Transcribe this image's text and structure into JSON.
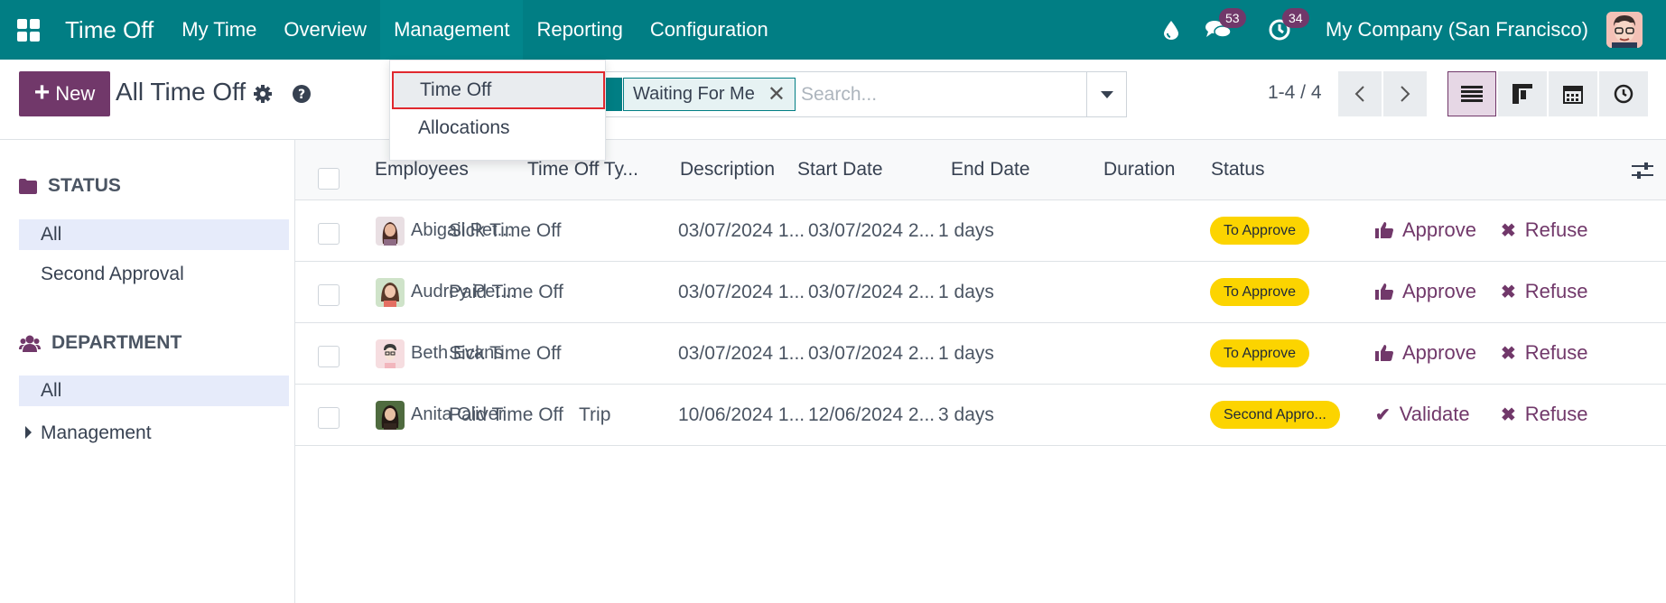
{
  "topbar": {
    "app_name": "Time Off",
    "menus": [
      {
        "label": "My Time",
        "active": false
      },
      {
        "label": "Overview",
        "active": false
      },
      {
        "label": "Management",
        "active": true
      },
      {
        "label": "Reporting",
        "active": false
      },
      {
        "label": "Configuration",
        "active": false
      }
    ],
    "messages_count": "53",
    "activities_count": "34",
    "company": "My Company (San Francisco)"
  },
  "control": {
    "new_label": "New",
    "title": "All Time Off",
    "facet": "Waiting For Me",
    "search_placeholder": "Search...",
    "pager": "1-4 / 4"
  },
  "dropdown": {
    "items": [
      "Time Off",
      "Allocations"
    ],
    "highlighted": "Time Off"
  },
  "sidebar": {
    "status_heading": "STATUS",
    "status_items": [
      "All",
      "Second Approval"
    ],
    "department_heading": "DEPARTMENT",
    "department_items": [
      "All",
      "Management"
    ]
  },
  "table": {
    "headers": [
      "Employees",
      "Time Off Ty...",
      "Description",
      "Start Date",
      "End Date",
      "Duration",
      "Status"
    ],
    "rows": [
      {
        "employee": "Abigail Pet...",
        "type": "Sick Time Off",
        "description": "",
        "start": "03/07/2024 1...",
        "end": "03/07/2024 2...",
        "duration": "1 days",
        "status": "To Approve",
        "action": "Approve",
        "refuse": "Refuse"
      },
      {
        "employee": "Audrey Pet...",
        "type": "Paid Time Off",
        "description": "",
        "start": "03/07/2024 1...",
        "end": "03/07/2024 2...",
        "duration": "1 days",
        "status": "To Approve",
        "action": "Approve",
        "refuse": "Refuse"
      },
      {
        "employee": "Beth Evans",
        "type": "Sick Time Off",
        "description": "",
        "start": "03/07/2024 1...",
        "end": "03/07/2024 2...",
        "duration": "1 days",
        "status": "To Approve",
        "action": "Approve",
        "refuse": "Refuse"
      },
      {
        "employee": "Anita Oliver",
        "type": "Paid Time Off",
        "description": "Trip",
        "start": "10/06/2024 1...",
        "end": "12/06/2024 2...",
        "duration": "3 days",
        "status": "Second Appro...",
        "action": "Validate",
        "refuse": "Refuse"
      }
    ]
  },
  "colors": {
    "navbar": "#017e84",
    "primary": "#71386a",
    "status_pill": "#fcd400",
    "highlight_border": "#e0282e"
  }
}
